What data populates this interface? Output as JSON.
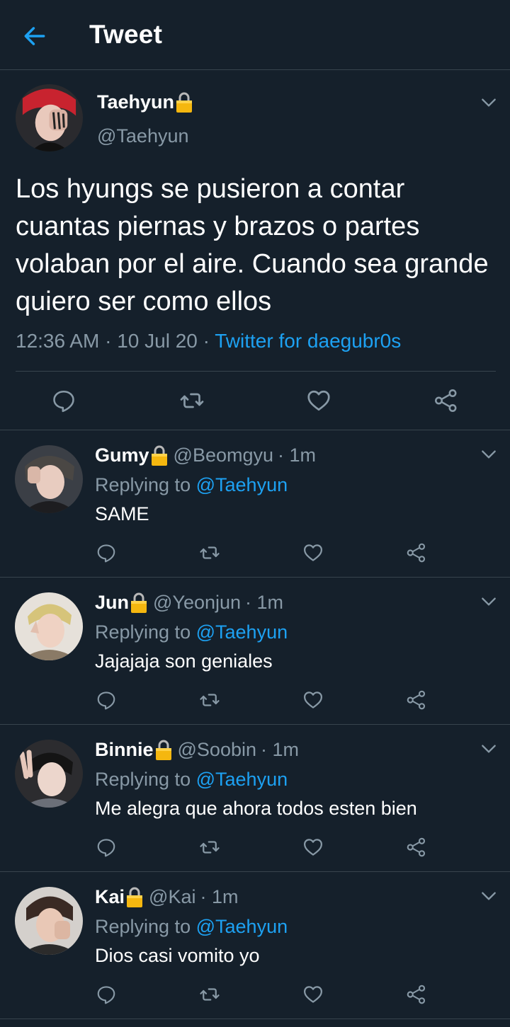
{
  "header": {
    "title": "Tweet",
    "back_icon": "arrow-left-icon"
  },
  "colors": {
    "background": "#15202b",
    "accent": "#1da1f2",
    "muted": "#8899a6",
    "divider": "#38444d",
    "lock": "#f5b70f"
  },
  "main_tweet": {
    "display_name": "Taehyun",
    "handle": "@Taehyun",
    "text": "Los hyungs se pusieron a contar cuantas piernas y brazos o partes volaban por el aire. Cuando sea grande quiero ser como ellos",
    "time": "12:36 AM",
    "separator": "·",
    "date": "10 Jul 20",
    "source": "Twitter for daegubr0s"
  },
  "replies": [
    {
      "name": "Gumy",
      "handle": "@Beomgyu",
      "time": "· 1m",
      "replying_label": "Replying to",
      "mention": "@Taehyun",
      "text": "SAME"
    },
    {
      "name": "Jun",
      "handle": "@Yeonjun",
      "time": "· 1m",
      "replying_label": "Replying to",
      "mention": "@Taehyun",
      "text": "Jajajaja son geniales"
    },
    {
      "name": "Binnie",
      "handle": "@Soobin",
      "time": "· 1m",
      "replying_label": "Replying to",
      "mention": "@Taehyun",
      "text": "Me alegra que ahora todos esten bien"
    },
    {
      "name": "Kai",
      "handle": "@Kai",
      "time": "· 1m",
      "replying_label": "Replying to",
      "mention": "@Taehyun",
      "text": "Dios casi vomito yo"
    }
  ]
}
